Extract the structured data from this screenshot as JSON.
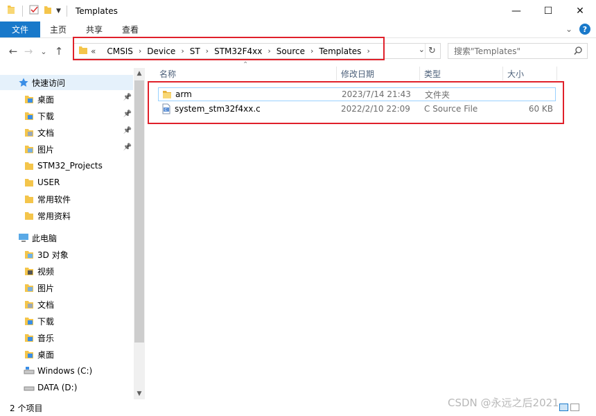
{
  "window": {
    "title": "Templates",
    "minimize_glyph": "—",
    "maximize_glyph": "☐",
    "close_glyph": "✕"
  },
  "ribbon": {
    "tabs": [
      "文件",
      "主页",
      "共享",
      "查看"
    ],
    "help_glyph": "?"
  },
  "nav": {
    "back_glyph": "←",
    "forward_glyph": "→",
    "recent_glyph": "⌄",
    "up_glyph": "↑",
    "overflow": "«",
    "breadcrumb": [
      "CMSIS",
      "Device",
      "ST",
      "STM32F4xx",
      "Source",
      "Templates"
    ],
    "search_placeholder": "搜索\"Templates\""
  },
  "sidebar": {
    "quick_access": "快速访问",
    "quick_items": [
      {
        "label": "桌面",
        "pinned": true,
        "icon": "desktop-folder-icon"
      },
      {
        "label": "下载",
        "pinned": true,
        "icon": "downloads-folder-icon"
      },
      {
        "label": "文档",
        "pinned": true,
        "icon": "documents-folder-icon"
      },
      {
        "label": "图片",
        "pinned": true,
        "icon": "pictures-folder-icon"
      },
      {
        "label": "STM32_Projects",
        "pinned": false,
        "icon": "folder-icon"
      },
      {
        "label": "USER",
        "pinned": false,
        "icon": "folder-icon"
      },
      {
        "label": "常用软件",
        "pinned": false,
        "icon": "folder-icon"
      },
      {
        "label": "常用资料",
        "pinned": false,
        "icon": "folder-icon"
      }
    ],
    "this_pc": "此电脑",
    "pc_items": [
      {
        "label": "3D 对象",
        "icon": "3d-objects-icon"
      },
      {
        "label": "视频",
        "icon": "videos-icon"
      },
      {
        "label": "图片",
        "icon": "pictures-folder-icon"
      },
      {
        "label": "文档",
        "icon": "documents-folder-icon"
      },
      {
        "label": "下载",
        "icon": "downloads-folder-icon"
      },
      {
        "label": "音乐",
        "icon": "music-icon"
      },
      {
        "label": "桌面",
        "icon": "desktop-folder-icon"
      },
      {
        "label": "Windows (C:)",
        "icon": "windows-drive-icon"
      },
      {
        "label": "DATA (D:)",
        "icon": "drive-icon"
      }
    ]
  },
  "columns": {
    "name": "名称",
    "date": "修改日期",
    "type": "类型",
    "size": "大小"
  },
  "files": [
    {
      "name": "arm",
      "date": "2023/7/14 21:43",
      "type": "文件夹",
      "size": "",
      "icon": "folder-icon"
    },
    {
      "name": "system_stm32f4xx.c",
      "date": "2022/2/10 22:09",
      "type": "C Source File",
      "size": "60 KB",
      "icon": "c-file-icon"
    }
  ],
  "status": {
    "item_count": "2 个项目"
  },
  "watermark": "CSDN @永远之后2021",
  "colors": {
    "accent": "#1979ca",
    "highlight_box": "#e0202a",
    "folder": "#f4c54b"
  }
}
